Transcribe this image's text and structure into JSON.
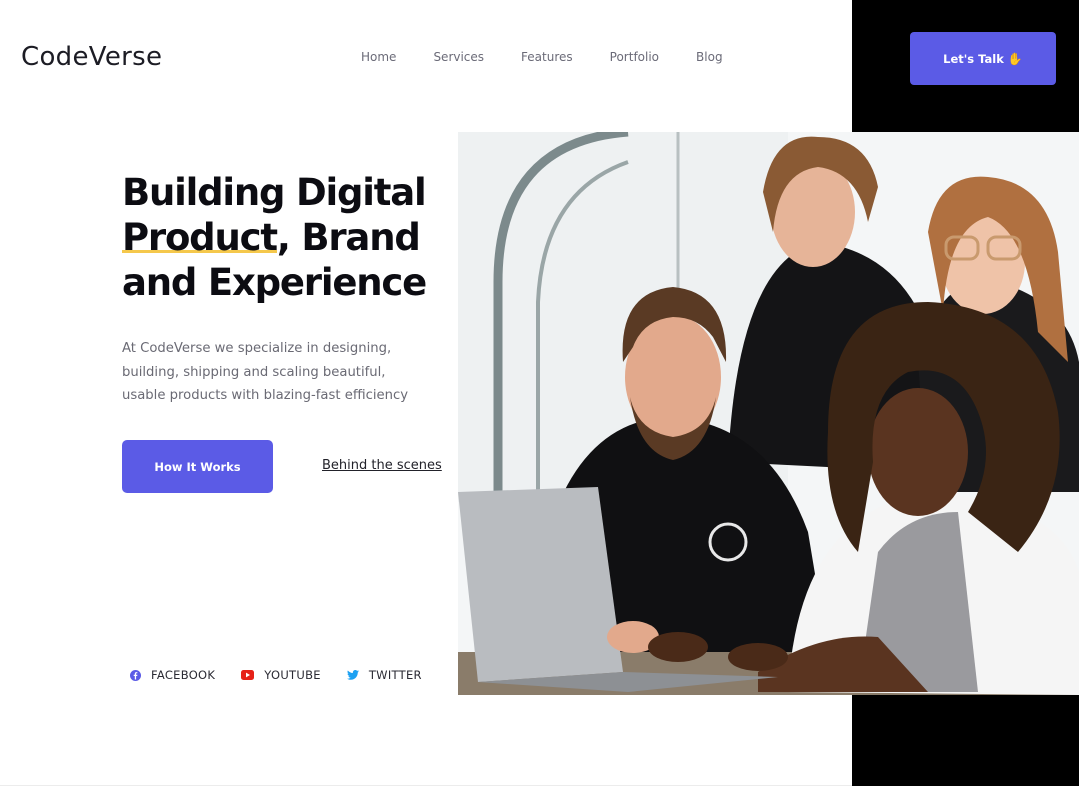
{
  "brand": {
    "name": "CodeVerse"
  },
  "nav": {
    "items": [
      "Home",
      "Services",
      "Features",
      "Portfolio",
      "Blog"
    ]
  },
  "cta": {
    "label": "Let's Talk",
    "icon": "waving-hand-icon"
  },
  "hero": {
    "title_line1": "Building Digital",
    "title_line2_underlined": "Product",
    "title_line2_rest": ", Brand",
    "title_line3": "and Experience",
    "description": "At CodeVerse we specialize in designing, building, shipping and scaling beautiful, usable products with blazing-fast efficiency",
    "primary_button": "How It Works",
    "secondary_link": "Behind the scenes"
  },
  "socials": [
    {
      "label": "FACEBOOK",
      "icon": "facebook-icon",
      "color": "#5b5be6"
    },
    {
      "label": "YOUTUBE",
      "icon": "youtube-icon",
      "color": "#e62117"
    },
    {
      "label": "TWITTER",
      "icon": "twitter-icon",
      "color": "#1da1f2"
    }
  ],
  "photo": {
    "icon": "team-photo",
    "subject": "four people working around a laptop"
  },
  "colors": {
    "accent": "#5b5be6",
    "underline": "#f5c84c",
    "dark": "#000000"
  }
}
